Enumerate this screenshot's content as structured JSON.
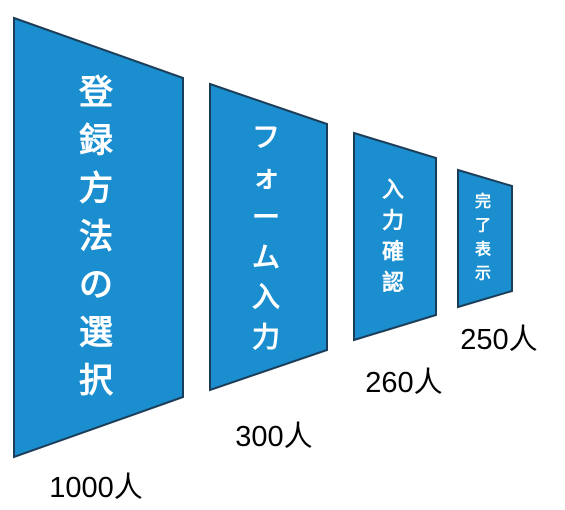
{
  "chart_data": {
    "type": "funnel",
    "colors": {
      "stage_fill": "#1a8ecf",
      "stage_stroke": "#1c3d57"
    },
    "stages": [
      {
        "label": "登録方法の選択",
        "value": 1000,
        "count_text": "1000人"
      },
      {
        "label": "フォーム入力",
        "value": 300,
        "count_text": "300人"
      },
      {
        "label": "入力確認",
        "value": 260,
        "count_text": "260人"
      },
      {
        "label": "完了表示",
        "value": 250,
        "count_text": "250人"
      }
    ]
  }
}
